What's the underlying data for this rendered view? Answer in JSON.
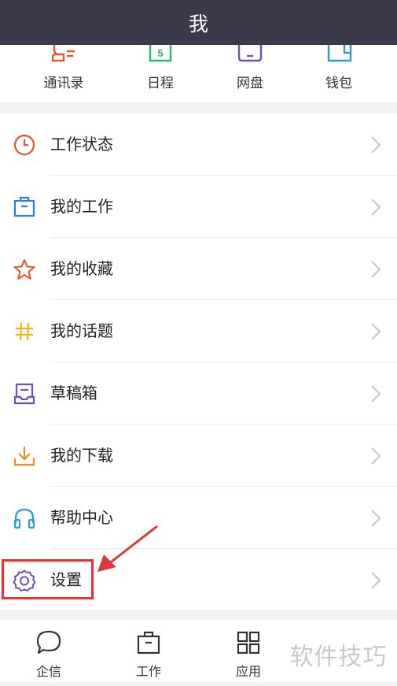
{
  "header": {
    "title": "我"
  },
  "quick_actions": [
    {
      "label": "通讯录",
      "icon": "contacts-icon"
    },
    {
      "label": "日程",
      "icon": "calendar-icon",
      "icon_text": "5"
    },
    {
      "label": "网盘",
      "icon": "cloud-drive-icon"
    },
    {
      "label": "钱包",
      "icon": "wallet-icon"
    }
  ],
  "menu": {
    "items": [
      {
        "label": "工作状态",
        "icon": "clock-icon",
        "color": "#e4572e"
      },
      {
        "label": "我的工作",
        "icon": "briefcase-icon",
        "color": "#2b7de1"
      },
      {
        "label": "我的收藏",
        "icon": "star-icon",
        "color": "#e4572e"
      },
      {
        "label": "我的话题",
        "icon": "hashtag-icon",
        "color": "#f2b319"
      },
      {
        "label": "草稿箱",
        "icon": "drafts-tray-icon",
        "color": "#6b4fbb"
      },
      {
        "label": "我的下载",
        "icon": "download-icon",
        "color": "#f08a24"
      },
      {
        "label": "帮助中心",
        "icon": "headphones-icon",
        "color": "#2b9ad8"
      },
      {
        "label": "设置",
        "icon": "gear-icon",
        "color": "#6b4fbb"
      }
    ]
  },
  "tabbar": {
    "tabs": [
      {
        "label": "企信",
        "icon": "chat-bubble-icon"
      },
      {
        "label": "工作",
        "icon": "briefcase-icon"
      },
      {
        "label": "应用",
        "icon": "apps-grid-icon"
      }
    ]
  },
  "watermark": {
    "text": "软件技巧"
  },
  "colors": {
    "header_bg": "#3b3a4c",
    "annotation_red": "#d9393a",
    "page_bg": "#f2f2f4"
  }
}
